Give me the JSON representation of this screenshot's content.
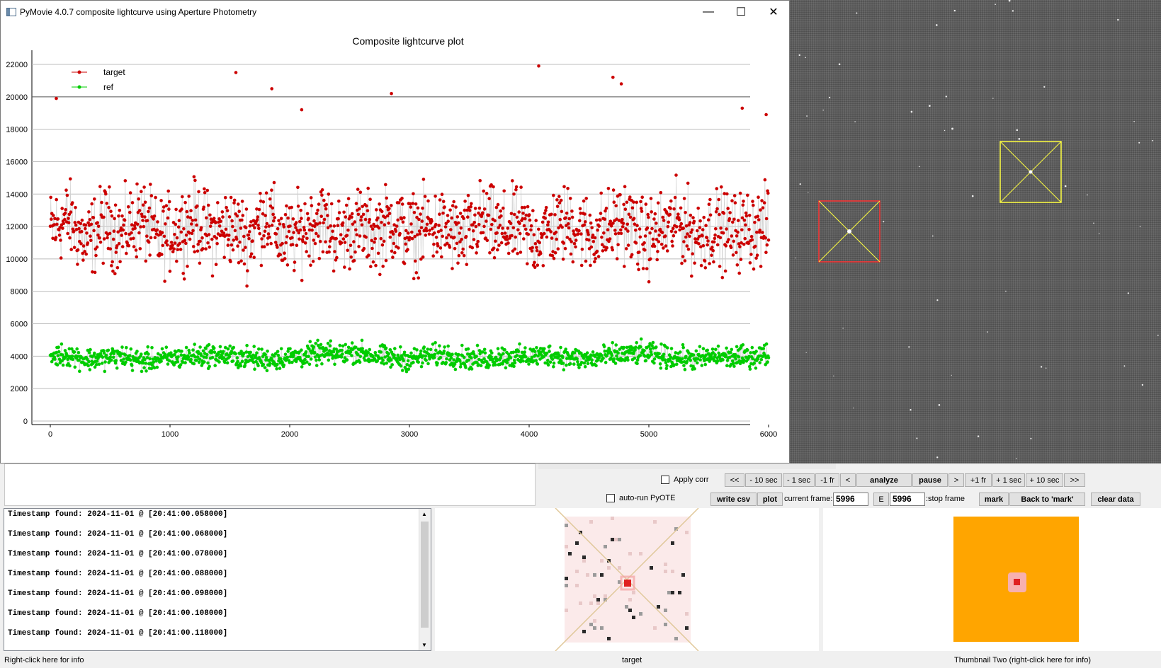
{
  "window": {
    "title": "PyMovie 4.0.7 composite lightcurve using Aperture Photometry",
    "minimize": "—",
    "maximize": "☐",
    "close": "✕"
  },
  "chart_data": {
    "type": "line",
    "title": "Composite lightcurve plot",
    "xlabel": "",
    "ylabel": "",
    "xlim": [
      0,
      6000
    ],
    "ylim": [
      0,
      22000
    ],
    "x_ticks": [
      "0",
      "1000",
      "2000",
      "3000",
      "4000",
      "5000",
      "6000"
    ],
    "y_ticks": [
      "0",
      "2000",
      "4000",
      "6000",
      "8000",
      "10000",
      "12000",
      "14000",
      "16000",
      "18000",
      "20000",
      "22000"
    ],
    "grid": true,
    "legend_position": "top-left",
    "series": [
      {
        "name": "target",
        "color": "#cc0000",
        "x": [
          0,
          150,
          300,
          450,
          600,
          750,
          900,
          1050,
          1200,
          1350,
          1500,
          1650,
          1800,
          1950,
          2100,
          2250,
          2400,
          2550,
          2700,
          2850,
          3000,
          3150,
          3300,
          3450,
          3600,
          3750,
          3900,
          4050,
          4200,
          4350,
          4500,
          4650,
          4800,
          4950,
          5100,
          5250,
          5400,
          5550,
          5700,
          5850,
          6000
        ],
        "values": [
          11800,
          12500,
          11000,
          12200,
          11500,
          12600,
          11200,
          11800,
          12400,
          11600,
          12000,
          11300,
          12800,
          11000,
          11700,
          12500,
          11400,
          12100,
          11600,
          12300,
          11500,
          12000,
          11800,
          11200,
          12400,
          11600,
          12000,
          11300,
          11900,
          12200,
          11500,
          11800,
          12500,
          11200,
          11700,
          12300,
          11400,
          12000,
          11600,
          11900,
          12000
        ],
        "spread": 3500,
        "peaks": [
          [
            50,
            19900
          ],
          [
            1550,
            21500
          ],
          [
            1850,
            20500
          ],
          [
            2100,
            19200
          ],
          [
            2850,
            20200
          ],
          [
            4080,
            21900
          ],
          [
            4700,
            21200
          ],
          [
            4770,
            20800
          ],
          [
            5780,
            19300
          ],
          [
            5980,
            18900
          ]
        ]
      },
      {
        "name": "ref",
        "color": "#00cc00",
        "x": [
          0,
          150,
          300,
          450,
          600,
          750,
          900,
          1050,
          1200,
          1350,
          1500,
          1650,
          1800,
          1950,
          2100,
          2250,
          2400,
          2550,
          2700,
          2850,
          3000,
          3150,
          3300,
          3450,
          3600,
          3750,
          3900,
          4050,
          4200,
          4350,
          4500,
          4650,
          4800,
          4950,
          5100,
          5250,
          5400,
          5550,
          5700,
          5850,
          6000
        ],
        "values": [
          4000,
          4100,
          3800,
          3900,
          4000,
          3700,
          3800,
          3900,
          4000,
          4100,
          4000,
          3900,
          3800,
          3900,
          4000,
          4200,
          4100,
          4300,
          4000,
          3900,
          3800,
          4000,
          4100,
          3900,
          3800,
          4000,
          3900,
          4000,
          4100,
          3900,
          3800,
          4000,
          4100,
          4200,
          4000,
          3900,
          3800,
          4000,
          3900,
          4000,
          4100
        ],
        "spread": 1000
      }
    ]
  },
  "controls": {
    "apply_corr": "Apply corr",
    "auto_run_pyote": "auto-run PyOTE",
    "nav_buttons": [
      "<<",
      "- 10 sec",
      "- 1 sec",
      "-1 fr",
      "<",
      "analyze",
      "pause",
      ">",
      "+1 fr",
      "+ 1 sec",
      "+ 10 sec",
      ">>"
    ],
    "write_csv": "write csv",
    "plot": "plot",
    "current_frame_label": "current frame:",
    "current_frame_value": "5996",
    "e_button": "E",
    "stop_frame_value": "5996",
    "stop_frame_label": ":stop frame",
    "mark": "mark",
    "back_to_mark": "Back to 'mark'",
    "clear_data": "clear data"
  },
  "log": {
    "lines": [
      "Timestamp found: 2024-11-01 @ [20:41:00.058000]",
      "Timestamp found: 2024-11-01 @ [20:41:00.068000]",
      "Timestamp found: 2024-11-01 @ [20:41:00.078000]",
      "Timestamp found: 2024-11-01 @ [20:41:00.088000]",
      "Timestamp found: 2024-11-01 @ [20:41:00.098000]",
      "Timestamp found: 2024-11-01 @ [20:41:00.108000]",
      "Timestamp found: 2024-11-01 @ [20:41:00.118000]"
    ]
  },
  "status": {
    "left": "Right-click here for info",
    "middle": "target",
    "right": "Thumbnail Two (right-click here for info)"
  },
  "colors": {
    "target_aperture": "#ff3030",
    "ref_aperture": "#ffff40",
    "thumbnail_two_bg": "#ffa500"
  }
}
